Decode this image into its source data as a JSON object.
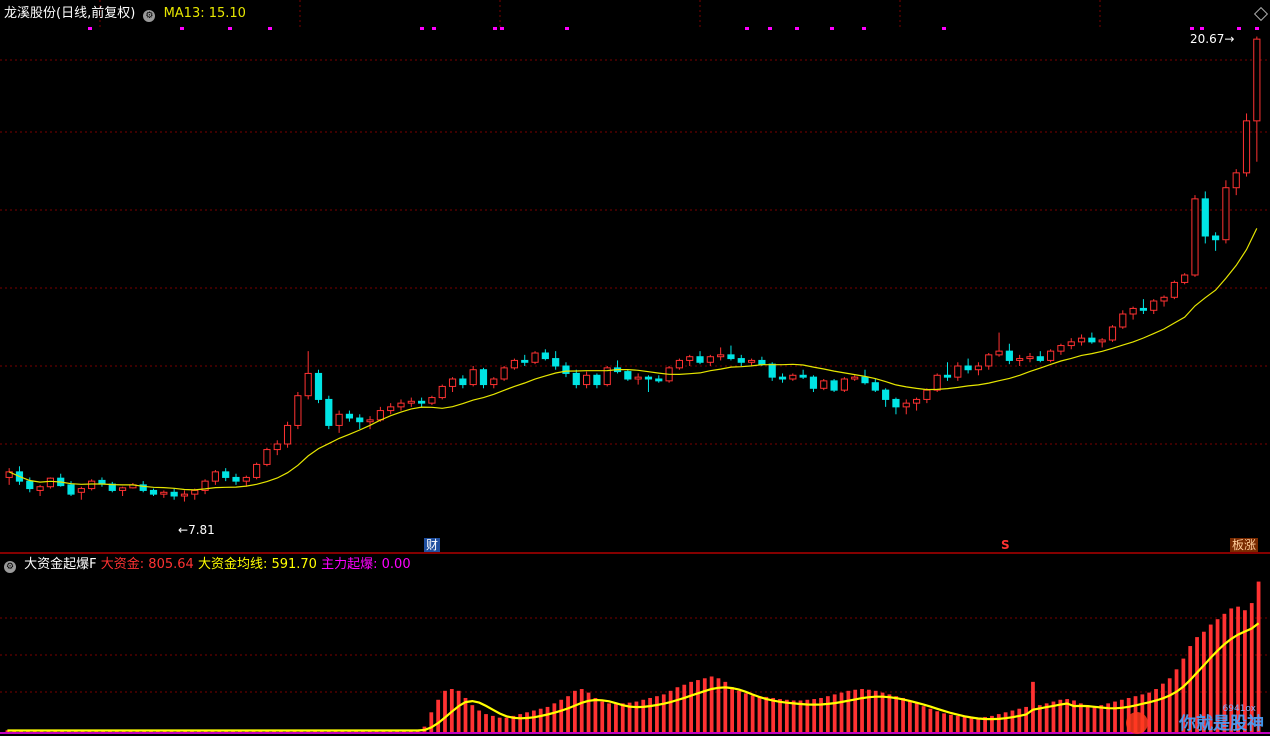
{
  "header": {
    "stock_title": "龙溪股份(日线,前复权)",
    "ma_label": "MA13:",
    "ma_value": "15.10"
  },
  "price_labels": {
    "high": "20.67",
    "low": "7.81"
  },
  "badges": {
    "cai": "财",
    "s": "S",
    "ban": "板涨"
  },
  "indicator": {
    "name": "大资金起爆F",
    "big_fund_label": "大资金:",
    "big_fund_value": "805.64",
    "avg_label": "大资金均线:",
    "avg_value": "591.70",
    "main_label": "主力起爆:",
    "main_value": "0.00"
  },
  "watermark": {
    "text": "你就是股神",
    "sub": "6941ox"
  },
  "colors": {
    "up": "#ff3232",
    "down": "#00e5e5",
    "ma": "#e6e600",
    "avg": "#ffff00",
    "magenta": "#ff00ff",
    "grid": "#7a0000",
    "title": "#ffffff"
  },
  "chart_data": [
    {
      "type": "candlestick",
      "title": "龙溪股份(日线,前复权)",
      "series": [
        {
          "name": "MA13",
          "values_note": "13-day moving average of close"
        }
      ],
      "y_range_approx": [
        7.81,
        20.67
      ],
      "marked_high": 20.67,
      "marked_low": 7.81,
      "candles": [
        [
          8.8,
          9.05,
          8.6,
          8.95
        ],
        [
          8.95,
          9.1,
          8.6,
          8.7
        ],
        [
          8.7,
          8.8,
          8.4,
          8.5
        ],
        [
          8.45,
          8.6,
          8.3,
          8.55
        ],
        [
          8.55,
          8.8,
          8.5,
          8.78
        ],
        [
          8.78,
          8.9,
          8.55,
          8.58
        ],
        [
          8.6,
          8.7,
          8.3,
          8.35
        ],
        [
          8.4,
          8.55,
          8.2,
          8.5
        ],
        [
          8.5,
          8.75,
          8.45,
          8.7
        ],
        [
          8.72,
          8.8,
          8.55,
          8.62
        ],
        [
          8.62,
          8.68,
          8.4,
          8.45
        ],
        [
          8.45,
          8.55,
          8.3,
          8.52
        ],
        [
          8.52,
          8.65,
          8.5,
          8.6
        ],
        [
          8.6,
          8.7,
          8.4,
          8.45
        ],
        [
          8.45,
          8.5,
          8.3,
          8.35
        ],
        [
          8.35,
          8.45,
          8.25,
          8.4
        ],
        [
          8.4,
          8.5,
          8.2,
          8.3
        ],
        [
          8.3,
          8.45,
          8.15,
          8.35
        ],
        [
          8.35,
          8.5,
          8.2,
          8.45
        ],
        [
          8.45,
          8.75,
          8.35,
          8.7
        ],
        [
          8.7,
          9.0,
          8.6,
          8.95
        ],
        [
          8.95,
          9.05,
          8.7,
          8.8
        ],
        [
          8.8,
          8.9,
          8.6,
          8.7
        ],
        [
          8.7,
          8.85,
          8.55,
          8.8
        ],
        [
          8.8,
          9.2,
          8.75,
          9.15
        ],
        [
          9.15,
          9.6,
          9.1,
          9.55
        ],
        [
          9.55,
          9.8,
          9.4,
          9.7
        ],
        [
          9.7,
          10.3,
          9.6,
          10.2
        ],
        [
          10.2,
          11.1,
          10.1,
          11.0
        ],
        [
          11.0,
          12.2,
          10.9,
          11.6
        ],
        [
          11.6,
          11.7,
          10.8,
          10.9
        ],
        [
          10.9,
          11.0,
          10.1,
          10.2
        ],
        [
          10.2,
          10.6,
          10.0,
          10.5
        ],
        [
          10.5,
          10.6,
          10.3,
          10.4
        ],
        [
          10.4,
          10.5,
          10.1,
          10.3
        ],
        [
          10.3,
          10.45,
          10.1,
          10.35
        ],
        [
          10.35,
          10.7,
          10.3,
          10.6
        ],
        [
          10.6,
          10.8,
          10.5,
          10.7
        ],
        [
          10.7,
          10.9,
          10.6,
          10.8
        ],
        [
          10.8,
          10.95,
          10.7,
          10.85
        ],
        [
          10.85,
          10.95,
          10.7,
          10.8
        ],
        [
          10.8,
          11.0,
          10.75,
          10.95
        ],
        [
          10.95,
          11.3,
          10.9,
          11.25
        ],
        [
          11.25,
          11.5,
          11.1,
          11.45
        ],
        [
          11.45,
          11.55,
          11.2,
          11.3
        ],
        [
          11.3,
          11.8,
          11.25,
          11.7
        ],
        [
          11.7,
          11.75,
          11.2,
          11.3
        ],
        [
          11.3,
          11.5,
          11.2,
          11.45
        ],
        [
          11.45,
          11.8,
          11.4,
          11.75
        ],
        [
          11.75,
          12.0,
          11.7,
          11.95
        ],
        [
          11.95,
          12.1,
          11.8,
          11.9
        ],
        [
          11.9,
          12.2,
          11.85,
          12.15
        ],
        [
          12.15,
          12.25,
          11.95,
          12.0
        ],
        [
          12.0,
          12.2,
          11.7,
          11.8
        ],
        [
          11.8,
          11.9,
          11.5,
          11.6
        ],
        [
          11.6,
          11.7,
          11.2,
          11.3
        ],
        [
          11.3,
          11.65,
          11.2,
          11.55
        ],
        [
          11.55,
          11.6,
          11.2,
          11.3
        ],
        [
          11.3,
          11.8,
          11.25,
          11.75
        ],
        [
          11.75,
          11.95,
          11.6,
          11.65
        ],
        [
          11.65,
          11.7,
          11.4,
          11.45
        ],
        [
          11.45,
          11.6,
          11.3,
          11.5
        ],
        [
          11.5,
          11.55,
          11.1,
          11.45
        ],
        [
          11.45,
          11.55,
          11.35,
          11.4
        ],
        [
          11.4,
          11.8,
          11.35,
          11.75
        ],
        [
          11.75,
          12.0,
          11.7,
          11.95
        ],
        [
          11.95,
          12.1,
          11.8,
          12.05
        ],
        [
          12.05,
          12.2,
          11.85,
          11.9
        ],
        [
          11.9,
          12.1,
          11.8,
          12.05
        ],
        [
          12.05,
          12.3,
          11.95,
          12.1
        ],
        [
          12.1,
          12.35,
          11.95,
          12.0
        ],
        [
          12.0,
          12.1,
          11.8,
          11.9
        ],
        [
          11.9,
          12.0,
          11.8,
          11.95
        ],
        [
          11.95,
          12.05,
          11.8,
          11.85
        ],
        [
          11.85,
          11.9,
          11.4,
          11.5
        ],
        [
          11.5,
          11.6,
          11.35,
          11.45
        ],
        [
          11.45,
          11.6,
          11.4,
          11.55
        ],
        [
          11.55,
          11.7,
          11.45,
          11.5
        ],
        [
          11.5,
          11.55,
          11.1,
          11.2
        ],
        [
          11.2,
          11.45,
          11.15,
          11.4
        ],
        [
          11.4,
          11.45,
          11.1,
          11.15
        ],
        [
          11.15,
          11.5,
          11.1,
          11.45
        ],
        [
          11.45,
          11.55,
          11.4,
          11.5
        ],
        [
          11.5,
          11.7,
          11.3,
          11.35
        ],
        [
          11.35,
          11.45,
          11.1,
          11.15
        ],
        [
          11.15,
          11.2,
          10.7,
          10.9
        ],
        [
          10.9,
          10.95,
          10.5,
          10.7
        ],
        [
          10.7,
          10.9,
          10.5,
          10.8
        ],
        [
          10.8,
          10.95,
          10.6,
          10.9
        ],
        [
          10.9,
          11.2,
          10.8,
          11.15
        ],
        [
          11.15,
          11.6,
          11.1,
          11.55
        ],
        [
          11.55,
          11.9,
          11.4,
          11.5
        ],
        [
          11.5,
          11.9,
          11.4,
          11.8
        ],
        [
          11.8,
          12.0,
          11.6,
          11.7
        ],
        [
          11.7,
          11.9,
          11.55,
          11.8
        ],
        [
          11.8,
          12.15,
          11.7,
          12.1
        ],
        [
          12.1,
          12.7,
          12.05,
          12.2
        ],
        [
          12.2,
          12.4,
          11.85,
          11.95
        ],
        [
          11.95,
          12.1,
          11.8,
          12.0
        ],
        [
          12.0,
          12.15,
          11.9,
          12.05
        ],
        [
          12.05,
          12.2,
          11.9,
          11.95
        ],
        [
          11.95,
          12.25,
          11.9,
          12.2
        ],
        [
          12.2,
          12.4,
          12.1,
          12.35
        ],
        [
          12.35,
          12.55,
          12.25,
          12.45
        ],
        [
          12.45,
          12.65,
          12.35,
          12.55
        ],
        [
          12.55,
          12.7,
          12.4,
          12.45
        ],
        [
          12.45,
          12.55,
          12.3,
          12.5
        ],
        [
          12.5,
          12.9,
          12.45,
          12.85
        ],
        [
          12.85,
          13.3,
          12.8,
          13.2
        ],
        [
          13.2,
          13.4,
          13.05,
          13.35
        ],
        [
          13.35,
          13.6,
          13.2,
          13.3
        ],
        [
          13.3,
          13.6,
          13.2,
          13.55
        ],
        [
          13.55,
          13.7,
          13.4,
          13.65
        ],
        [
          13.65,
          14.1,
          13.6,
          14.05
        ],
        [
          14.05,
          14.3,
          14.0,
          14.25
        ],
        [
          14.25,
          16.4,
          14.2,
          16.3
        ],
        [
          16.3,
          16.5,
          15.1,
          15.3
        ],
        [
          15.3,
          15.4,
          14.9,
          15.2
        ],
        [
          15.2,
          16.8,
          15.1,
          16.6
        ],
        [
          16.6,
          17.1,
          16.4,
          17.0
        ],
        [
          17.0,
          18.6,
          16.9,
          18.4
        ],
        [
          18.4,
          20.67,
          17.3,
          20.6
        ]
      ]
    },
    {
      "type": "bar",
      "title": "大资金起爆F",
      "series": [
        {
          "name": "大资金",
          "last": 805.64
        },
        {
          "name": "大资金均线",
          "last": 591.7
        },
        {
          "name": "主力起爆",
          "last": 0.0
        }
      ],
      "values": [
        5,
        5,
        5,
        5,
        5,
        5,
        5,
        5,
        5,
        5,
        5,
        5,
        5,
        5,
        5,
        5,
        5,
        5,
        5,
        5,
        5,
        5,
        5,
        5,
        5,
        5,
        5,
        5,
        5,
        5,
        5,
        5,
        5,
        5,
        5,
        5,
        5,
        5,
        5,
        5,
        5,
        5,
        5,
        5,
        5,
        5,
        5,
        5,
        5,
        5,
        5,
        5,
        5,
        5,
        5,
        5,
        5,
        5,
        5,
        5,
        5,
        15,
        55,
        90,
        115,
        120,
        115,
        95,
        75,
        60,
        50,
        45,
        40,
        40,
        45,
        50,
        55,
        60,
        65,
        70,
        80,
        90,
        100,
        115,
        120,
        110,
        95,
        85,
        80,
        78,
        80,
        82,
        85,
        90,
        95,
        100,
        105,
        115,
        125,
        132,
        140,
        145,
        150,
        155,
        150,
        140,
        125,
        115,
        108,
        102,
        100,
        98,
        95,
        92,
        90,
        88,
        88,
        90,
        92,
        95,
        100,
        105,
        110,
        115,
        118,
        120,
        118,
        115,
        110,
        105,
        100,
        95,
        88,
        80,
        72,
        65,
        58,
        52,
        48,
        45,
        42,
        40,
        40,
        42,
        45,
        50,
        55,
        60,
        65,
        70,
        140,
        75,
        80,
        85,
        90,
        92,
        88,
        80,
        75,
        72,
        75,
        80,
        85,
        90,
        95,
        100,
        105,
        110,
        120,
        135,
        150,
        175,
        205,
        240,
        265,
        280,
        300,
        315,
        330,
        345,
        350,
        340,
        360,
        420
      ]
    }
  ]
}
